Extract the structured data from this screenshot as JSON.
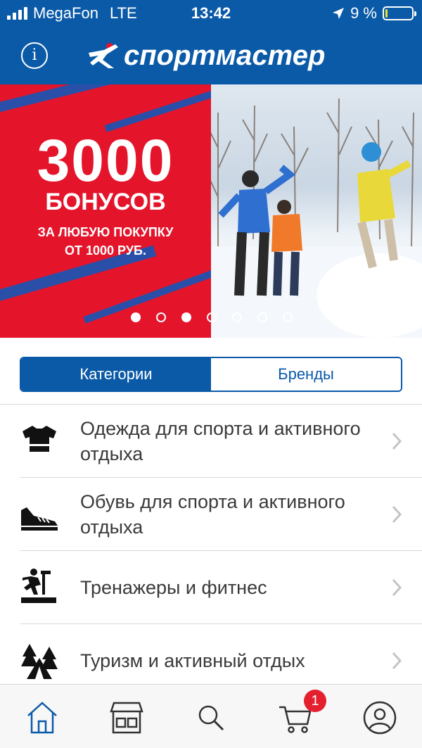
{
  "status_bar": {
    "carrier": "MegaFon",
    "network": "LTE",
    "time": "13:42",
    "battery_percent_text": "9 %",
    "battery_level": 0.09,
    "battery_color": "#f2e21b"
  },
  "header": {
    "info_button_glyph": "i",
    "logo_text": "спортмастер",
    "background": "#0a5aa8"
  },
  "banner": {
    "amount": "3000",
    "bonus": "БОНУСОВ",
    "line1": "ЗА ЛЮБУЮ ПОКУПКУ",
    "line2": "ОТ 1000 РУБ.",
    "slides_total": 7,
    "active_slides": [
      0,
      2
    ]
  },
  "segment": {
    "categories_label": "Категории",
    "brands_label": "Бренды",
    "selected": "categories"
  },
  "categories": [
    {
      "label": "Одежда для спорта и активного отдыха",
      "icon": "tshirt-icon"
    },
    {
      "label": "Обувь для спорта и активного отдыха",
      "icon": "sneaker-icon"
    },
    {
      "label": "Тренажеры и фитнес",
      "icon": "treadmill-icon"
    },
    {
      "label": "Туризм и активный отдых",
      "icon": "tent-trees-icon"
    }
  ],
  "tabbar": {
    "items": [
      "home-icon",
      "store-icon",
      "search-icon",
      "cart-icon",
      "profile-icon"
    ],
    "cart_badge": "1",
    "active_color": "#0a5aa8"
  }
}
